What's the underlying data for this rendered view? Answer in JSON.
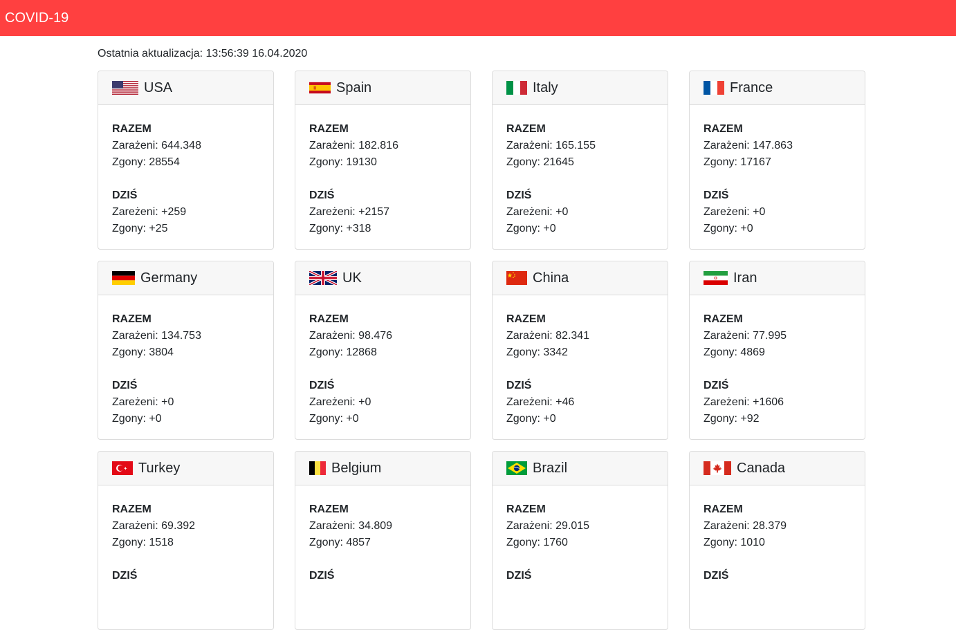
{
  "header": {
    "title": "COVID-19"
  },
  "last_update": "Ostatnia aktualizacja: 13:56:39 16.04.2020",
  "colors": {
    "topbar": "#ff4040"
  },
  "labels": {
    "total": "RAZEM",
    "today": "DZIŚ"
  },
  "countries": [
    {
      "name": "USA",
      "flag": "us-flag-icon",
      "total_infected": "Zarażeni: 644.348",
      "total_deaths": "Zgony: 28554",
      "today_infected": "Zareżeni: +259",
      "today_deaths": "Zgony: +25"
    },
    {
      "name": "Spain",
      "flag": "es-flag-icon",
      "total_infected": "Zarażeni: 182.816",
      "total_deaths": "Zgony: 19130",
      "today_infected": "Zareżeni: +2157",
      "today_deaths": "Zgony: +318"
    },
    {
      "name": "Italy",
      "flag": "it-flag-icon",
      "total_infected": "Zarażeni: 165.155",
      "total_deaths": "Zgony: 21645",
      "today_infected": "Zareżeni: +0",
      "today_deaths": "Zgony: +0"
    },
    {
      "name": "France",
      "flag": "fr-flag-icon",
      "total_infected": "Zarażeni: 147.863",
      "total_deaths": "Zgony: 17167",
      "today_infected": "Zareżeni: +0",
      "today_deaths": "Zgony: +0"
    },
    {
      "name": "Germany",
      "flag": "de-flag-icon",
      "total_infected": "Zarażeni: 134.753",
      "total_deaths": "Zgony: 3804",
      "today_infected": "Zareżeni: +0",
      "today_deaths": "Zgony: +0"
    },
    {
      "name": "UK",
      "flag": "gb-flag-icon",
      "total_infected": "Zarażeni: 98.476",
      "total_deaths": "Zgony: 12868",
      "today_infected": "Zareżeni: +0",
      "today_deaths": "Zgony: +0"
    },
    {
      "name": "China",
      "flag": "cn-flag-icon",
      "total_infected": "Zarażeni: 82.341",
      "total_deaths": "Zgony: 3342",
      "today_infected": "Zareżeni: +46",
      "today_deaths": "Zgony: +0"
    },
    {
      "name": "Iran",
      "flag": "ir-flag-icon",
      "total_infected": "Zarażeni: 77.995",
      "total_deaths": "Zgony: 4869",
      "today_infected": "Zareżeni: +1606",
      "today_deaths": "Zgony: +92"
    },
    {
      "name": "Turkey",
      "flag": "tr-flag-icon",
      "total_infected": "Zarażeni: 69.392",
      "total_deaths": "Zgony: 1518",
      "today_infected": "",
      "today_deaths": ""
    },
    {
      "name": "Belgium",
      "flag": "be-flag-icon",
      "total_infected": "Zarażeni: 34.809",
      "total_deaths": "Zgony: 4857",
      "today_infected": "",
      "today_deaths": ""
    },
    {
      "name": "Brazil",
      "flag": "br-flag-icon",
      "total_infected": "Zarażeni: 29.015",
      "total_deaths": "Zgony: 1760",
      "today_infected": "",
      "today_deaths": ""
    },
    {
      "name": "Canada",
      "flag": "ca-flag-icon",
      "total_infected": "Zarażeni: 28.379",
      "total_deaths": "Zgony: 1010",
      "today_infected": "",
      "today_deaths": ""
    }
  ]
}
